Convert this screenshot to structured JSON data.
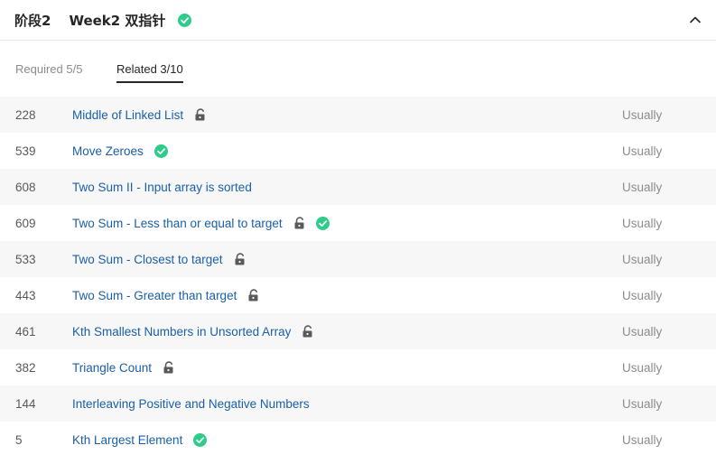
{
  "header": {
    "stage": "阶段2",
    "week": "Week2 双指针",
    "completed": true
  },
  "tabs": [
    {
      "label": "Required 5/5",
      "active": false
    },
    {
      "label": "Related 3/10",
      "active": true
    }
  ],
  "colors": {
    "link": "#1a5fa8",
    "check_green": "#2dcc8a",
    "row_alt": "#f7f7f7",
    "lock_gray": "#595959"
  },
  "problems": [
    {
      "id": "228",
      "title": "Middle of Linked List",
      "locked": true,
      "solved": false,
      "frequency": "Usually"
    },
    {
      "id": "539",
      "title": "Move Zeroes",
      "locked": false,
      "solved": true,
      "frequency": "Usually"
    },
    {
      "id": "608",
      "title": "Two Sum II - Input array is sorted",
      "locked": false,
      "solved": false,
      "frequency": "Usually"
    },
    {
      "id": "609",
      "title": "Two Sum - Less than or equal to target",
      "locked": true,
      "solved": true,
      "frequency": "Usually"
    },
    {
      "id": "533",
      "title": "Two Sum - Closest to target",
      "locked": true,
      "solved": false,
      "frequency": "Usually"
    },
    {
      "id": "443",
      "title": "Two Sum - Greater than target",
      "locked": true,
      "solved": false,
      "frequency": "Usually"
    },
    {
      "id": "461",
      "title": "Kth Smallest Numbers in Unsorted Array",
      "locked": true,
      "solved": false,
      "frequency": "Usually"
    },
    {
      "id": "382",
      "title": "Triangle Count",
      "locked": true,
      "solved": false,
      "frequency": "Usually"
    },
    {
      "id": "144",
      "title": "Interleaving Positive and Negative Numbers",
      "locked": false,
      "solved": false,
      "frequency": "Usually"
    },
    {
      "id": "5",
      "title": "Kth Largest Element",
      "locked": false,
      "solved": true,
      "frequency": "Usually"
    }
  ]
}
